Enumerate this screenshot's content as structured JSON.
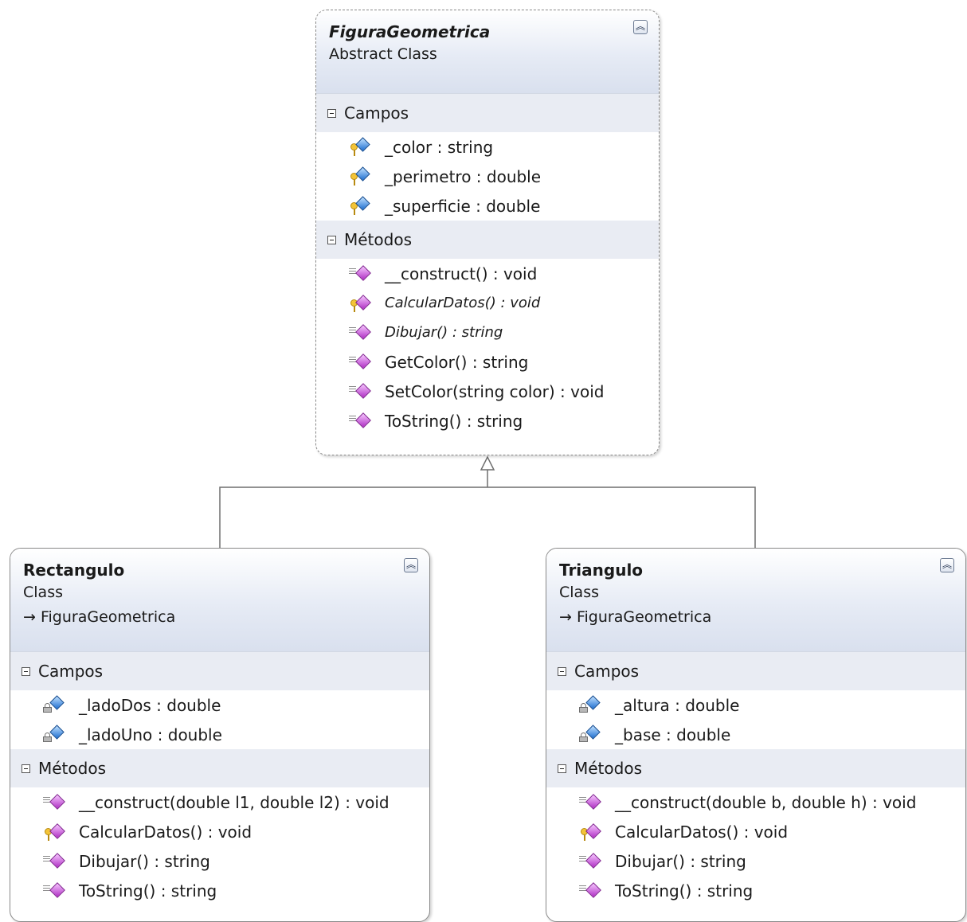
{
  "diagram": {
    "section_fields_label": "Campos",
    "section_methods_label": "Métodos",
    "collapse_glyph": "︽",
    "inherit_arrow": "→",
    "classes": [
      {
        "name": "FiguraGeometrica",
        "kind": "Abstract Class",
        "abstract": true,
        "base": "",
        "fields": [
          {
            "text": "_color : string",
            "access": "protected"
          },
          {
            "text": "_perimetro : double",
            "access": "protected"
          },
          {
            "text": "_superficie : double",
            "access": "protected"
          }
        ],
        "methods": [
          {
            "text": "__construct() : void",
            "access": "public",
            "italic": false
          },
          {
            "text": "CalcularDatos() : void",
            "access": "protected",
            "italic": true
          },
          {
            "text": "Dibujar() : string",
            "access": "public",
            "italic": true
          },
          {
            "text": "GetColor() : string",
            "access": "public",
            "italic": false
          },
          {
            "text": "SetColor(string color) : void",
            "access": "public",
            "italic": false
          },
          {
            "text": "ToString() : string",
            "access": "public",
            "italic": false
          }
        ]
      },
      {
        "name": "Rectangulo",
        "kind": "Class",
        "abstract": false,
        "base": "FiguraGeometrica",
        "fields": [
          {
            "text": "_ladoDos : double",
            "access": "private"
          },
          {
            "text": "_ladoUno : double",
            "access": "private"
          }
        ],
        "methods": [
          {
            "text": "__construct(double l1, double l2) : void",
            "access": "public",
            "italic": false
          },
          {
            "text": "CalcularDatos() : void",
            "access": "protected",
            "italic": false
          },
          {
            "text": "Dibujar() : string",
            "access": "public",
            "italic": false
          },
          {
            "text": "ToString() : string",
            "access": "public",
            "italic": false
          }
        ]
      },
      {
        "name": "Triangulo",
        "kind": "Class",
        "abstract": false,
        "base": "FiguraGeometrica",
        "fields": [
          {
            "text": "_altura : double",
            "access": "private"
          },
          {
            "text": "_base : double",
            "access": "private"
          }
        ],
        "methods": [
          {
            "text": "__construct(double b, double h) : void",
            "access": "public",
            "italic": false
          },
          {
            "text": "CalcularDatos() : void",
            "access": "protected",
            "italic": false
          },
          {
            "text": "Dibujar() : string",
            "access": "public",
            "italic": false
          },
          {
            "text": "ToString() : string",
            "access": "public",
            "italic": false
          }
        ]
      }
    ]
  }
}
